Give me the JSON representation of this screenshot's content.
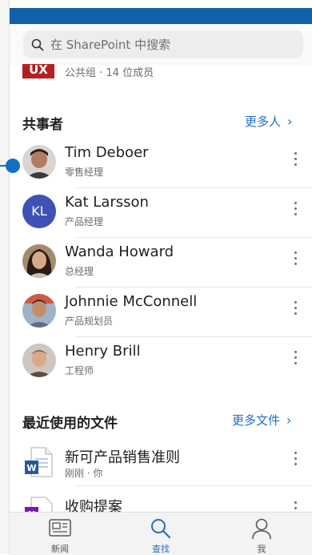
{
  "search": {
    "placeholder": "在 SharePoint 中搜索"
  },
  "group": {
    "logo_text": "UX",
    "subtitle": "公共组 · 14 位成员"
  },
  "colleagues": {
    "title": "共事者",
    "more_label": "更多人",
    "people": [
      {
        "name": "Tim Deboer",
        "role": "零售经理",
        "avatar": "photo"
      },
      {
        "name": "Kat Larsson",
        "role": "产品经理",
        "avatar": "KL"
      },
      {
        "name": "Wanda Howard",
        "role": "总经理",
        "avatar": "photo"
      },
      {
        "name": "Johnnie McConnell",
        "role": "产品规划员",
        "avatar": "photo"
      },
      {
        "name": "Henry Brill",
        "role": "工程师",
        "avatar": "photo"
      }
    ]
  },
  "files": {
    "title": "最近使用的文件",
    "more_label": "更多文件",
    "items": [
      {
        "name": "新可产品销售准则",
        "meta": "刚刚 · 你",
        "icon": "word-doc-icon"
      },
      {
        "name": "收购提案",
        "meta": "",
        "icon": "onenote-icon"
      }
    ]
  },
  "nav": {
    "items": [
      {
        "label": "新闻",
        "icon": "news-icon"
      },
      {
        "label": "查找",
        "icon": "search-icon",
        "active": true
      },
      {
        "label": "我",
        "icon": "person-icon"
      }
    ]
  },
  "colors": {
    "accent": "#1f70c1",
    "topbar": "#0f62a8",
    "group_logo": "#b51f1f",
    "kl_avatar": "#3f51b5"
  }
}
